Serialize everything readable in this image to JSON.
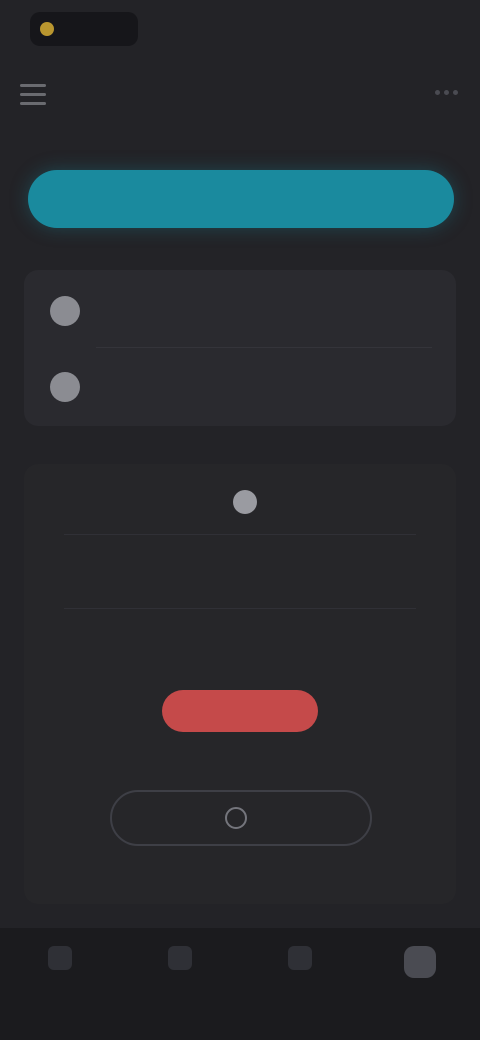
{
  "status_bar": {
    "text": ""
  },
  "header": {
    "title": ""
  },
  "cta": {
    "label": ""
  },
  "settings": {
    "rows": [
      {
        "icon": "globe-icon",
        "label": "",
        "value": ""
      },
      {
        "icon": "bell-icon",
        "label": "",
        "value": ""
      }
    ]
  },
  "account": {
    "item1": "",
    "item2": "",
    "item3": "",
    "danger_label": "",
    "outline_label": "",
    "footer_link": ""
  },
  "nav": {
    "items": [
      {
        "icon": "home-icon",
        "label": ""
      },
      {
        "icon": "list-icon",
        "label": ""
      },
      {
        "icon": "chart-icon",
        "label": ""
      },
      {
        "icon": "profile-icon",
        "label": "",
        "active": true
      }
    ]
  },
  "colors": {
    "background": "#232327",
    "accent": "#1a8a9e",
    "danger": "#c54a4a",
    "card": "#2a2a2f"
  }
}
